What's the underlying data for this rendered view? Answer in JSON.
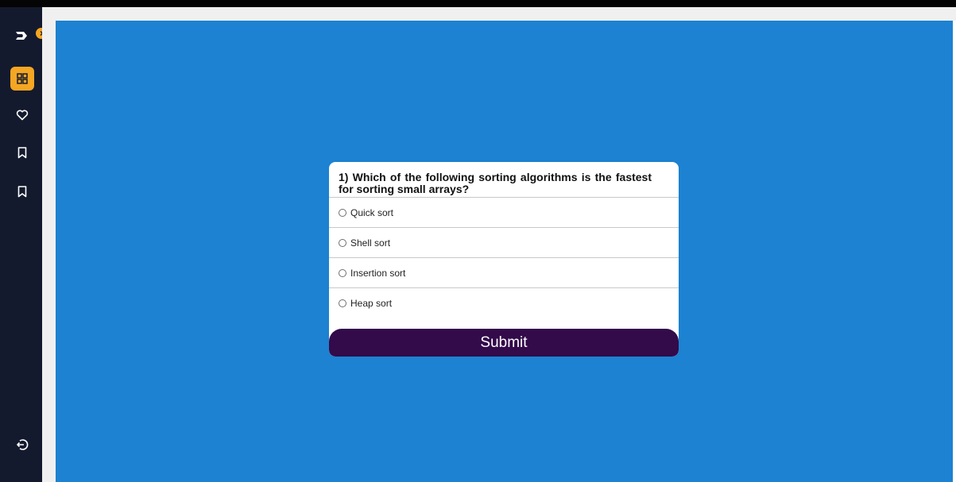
{
  "colors": {
    "sidebar_bg": "#141a2e",
    "accent": "#f5a623",
    "main_bg": "#1c82d1",
    "card_bg": "#ffffff",
    "submit_bg": "#330a4a"
  },
  "sidebar": {
    "logo_icon": "logo-icon",
    "expand_icon": "chevron-right-icon",
    "items": [
      {
        "icon": "grid-icon",
        "active": true
      },
      {
        "icon": "heart-icon",
        "active": false
      },
      {
        "icon": "bookmark-icon",
        "active": false
      },
      {
        "icon": "bookmark-icon",
        "active": false
      }
    ],
    "logout_icon": "logout-icon"
  },
  "quiz": {
    "question": "1) Which of the following sorting algorithms is the fastest for sorting small arrays?",
    "options": [
      {
        "label": "Quick sort",
        "selected": false
      },
      {
        "label": "Shell sort",
        "selected": false
      },
      {
        "label": "Insertion sort",
        "selected": false
      },
      {
        "label": "Heap sort",
        "selected": false
      }
    ],
    "submit_label": "Submit"
  }
}
